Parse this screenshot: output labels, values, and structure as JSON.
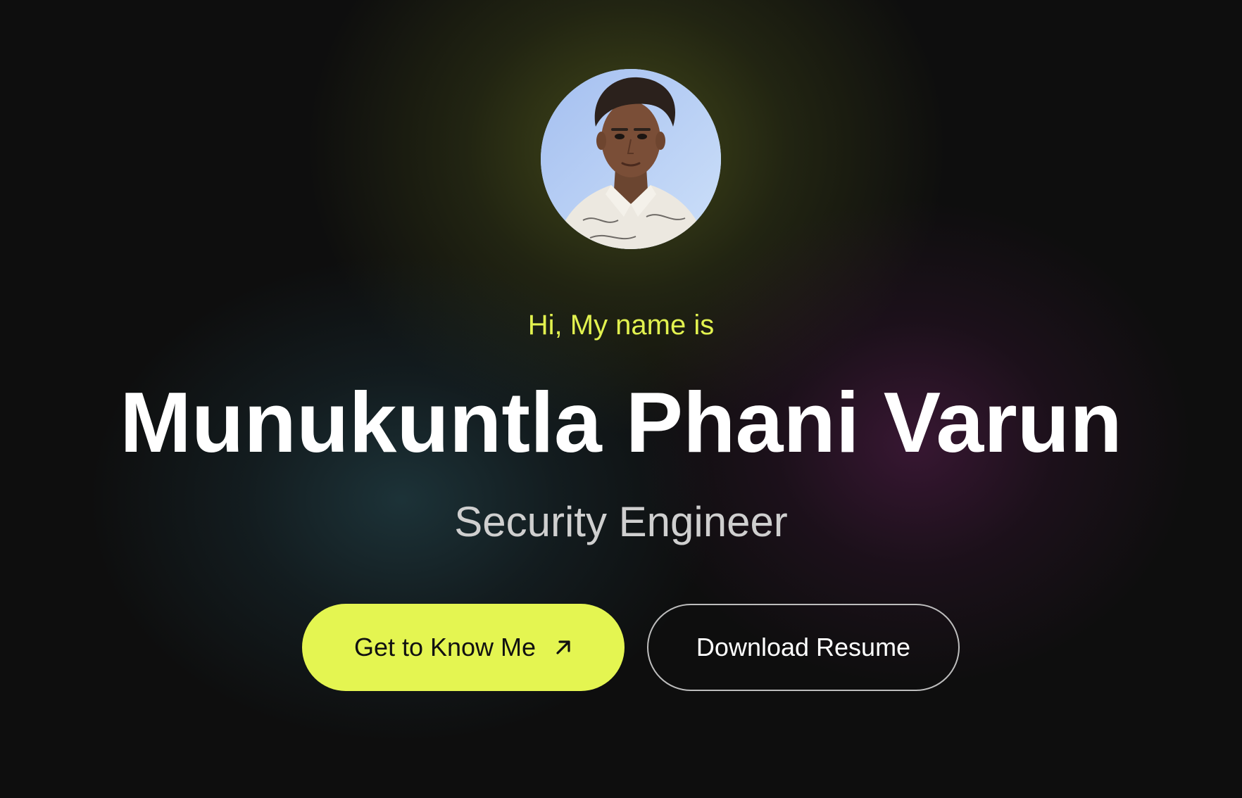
{
  "hero": {
    "greeting": "Hi, My name is",
    "name": "Munukuntla Phani Varun",
    "role": "Security Engineer",
    "primary_button_label": "Get to Know Me",
    "primary_button_icon": "arrow-up-right-icon",
    "secondary_button_label": "Download Resume"
  },
  "colors": {
    "background": "#0e0e0e",
    "accent": "#e4f551",
    "greeting_text": "#e2f24f",
    "name_text": "#ffffff",
    "role_text": "#cfcfcf",
    "secondary_border": "#bdbdbd"
  }
}
